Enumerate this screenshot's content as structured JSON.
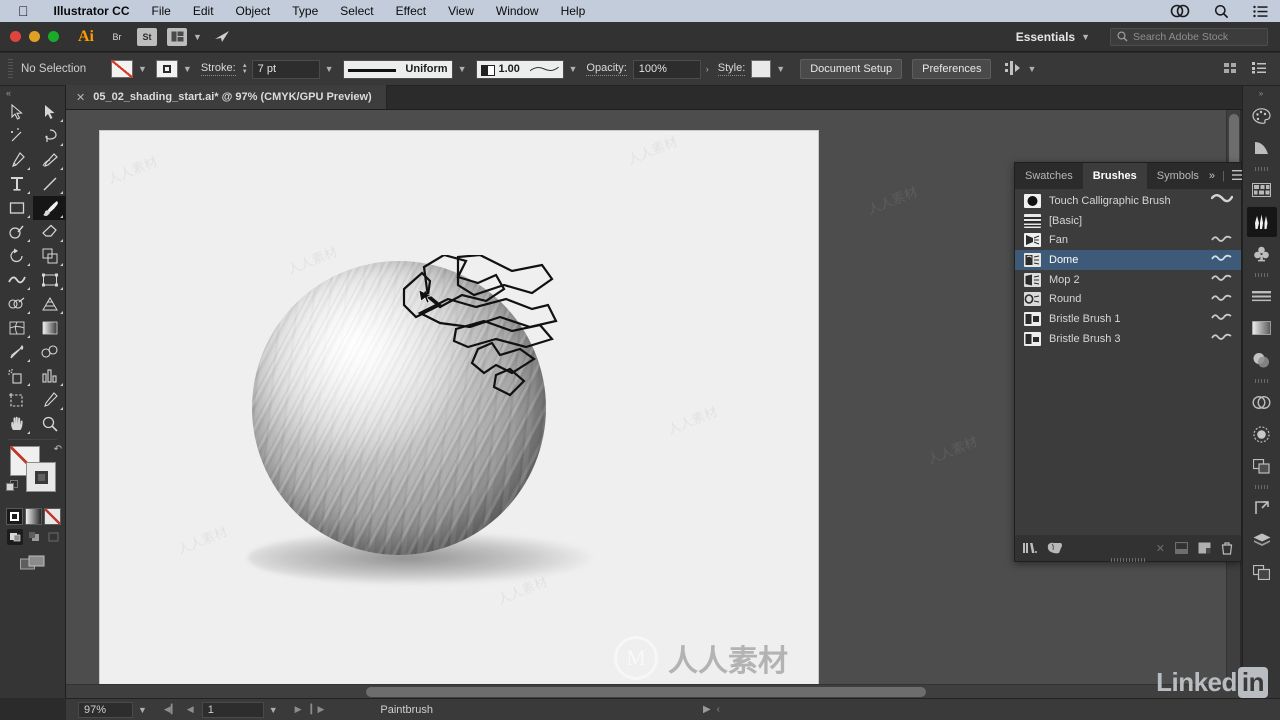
{
  "menubar": {
    "apple_icon": "apple-logo-icon",
    "app_name": "Illustrator CC",
    "items": [
      "File",
      "Edit",
      "Object",
      "Type",
      "Select",
      "Effect",
      "View",
      "Window",
      "Help"
    ],
    "right_icons": [
      "creative-cloud-icon",
      "spotlight-search-icon",
      "notification-center-icon"
    ]
  },
  "appbar": {
    "logo": "Ai",
    "buttons": [
      "bridge-icon",
      "stock-icon",
      "arrange-documents-icon"
    ],
    "mobile_icon": "share-on-behance-icon",
    "workspace": "Essentials",
    "workspace_chevron": "chevron-down-icon",
    "search": {
      "placeholder": "Search Adobe Stock",
      "icon": "search-icon"
    }
  },
  "controlbar": {
    "selection_status": "No Selection",
    "fill_swatch": "none-fill-swatch",
    "stroke_swatch": "stroke-swatch",
    "stroke_label": "Stroke:",
    "stroke_weight": "7 pt",
    "stroke_profile": "Uniform",
    "brush_definition": "1.00",
    "opacity_label": "Opacity:",
    "opacity_value": "100%",
    "style_label": "Style:",
    "document_setup": "Document Setup",
    "preferences": "Preferences",
    "right_icons": [
      "align-icon",
      "transform-icon",
      "properties-icon"
    ]
  },
  "tab": {
    "close_icon": "close-icon",
    "title": "05_02_shading_start.ai* @ 97% (CMYK/GPU Preview)"
  },
  "toolbar": {
    "tools": [
      {
        "name": "selection-tool",
        "label": "Selection"
      },
      {
        "name": "direct-selection-tool",
        "label": "Direct Selection"
      },
      {
        "name": "magic-wand-tool",
        "label": "Magic Wand"
      },
      {
        "name": "lasso-tool",
        "label": "Lasso"
      },
      {
        "name": "pen-tool",
        "label": "Pen"
      },
      {
        "name": "curvature-tool",
        "label": "Curvature"
      },
      {
        "name": "type-tool",
        "label": "Type"
      },
      {
        "name": "line-segment-tool",
        "label": "Line Segment"
      },
      {
        "name": "rectangle-tool",
        "label": "Rectangle"
      },
      {
        "name": "paintbrush-tool",
        "label": "Paintbrush"
      },
      {
        "name": "shaper-tool",
        "label": "Shaper"
      },
      {
        "name": "eraser-tool",
        "label": "Eraser"
      },
      {
        "name": "rotate-tool",
        "label": "Rotate"
      },
      {
        "name": "scale-tool",
        "label": "Scale"
      },
      {
        "name": "width-tool",
        "label": "Width"
      },
      {
        "name": "free-transform-tool",
        "label": "Free Transform"
      },
      {
        "name": "shape-builder-tool",
        "label": "Shape Builder"
      },
      {
        "name": "perspective-grid-tool",
        "label": "Perspective Grid"
      },
      {
        "name": "mesh-tool",
        "label": "Mesh"
      },
      {
        "name": "gradient-tool",
        "label": "Gradient"
      },
      {
        "name": "eyedropper-tool",
        "label": "Eyedropper"
      },
      {
        "name": "blend-tool",
        "label": "Blend"
      },
      {
        "name": "symbol-sprayer-tool",
        "label": "Symbol Sprayer"
      },
      {
        "name": "column-graph-tool",
        "label": "Column Graph"
      },
      {
        "name": "artboard-tool",
        "label": "Artboard"
      },
      {
        "name": "slice-tool",
        "label": "Slice"
      },
      {
        "name": "hand-tool",
        "label": "Hand"
      },
      {
        "name": "zoom-tool",
        "label": "Zoom"
      }
    ],
    "selected_tool": "paintbrush-tool",
    "fill_swatch": "fill-none-swatch",
    "stroke_swatch": "stroke-gray-swatch",
    "swap_icon": "swap-fill-stroke-icon",
    "default_icon": "default-fill-stroke-icon",
    "mode_buttons": [
      "color-mode-button",
      "gradient-mode-button",
      "none-mode-button"
    ],
    "draw_modes": [
      "draw-normal-button",
      "draw-behind-button",
      "draw-inside-button"
    ],
    "screen_mode": "change-screen-mode-button"
  },
  "canvas": {
    "artwork": "shaded-sphere-with-bristle-brush-strokes",
    "selected_path": "bristle-brush-path-outline",
    "cursor": "paintbrush-cursor"
  },
  "panel": {
    "tabs": [
      {
        "label": "Swatches",
        "active": false
      },
      {
        "label": "Brushes",
        "active": true
      },
      {
        "label": "Symbols",
        "active": false
      }
    ],
    "expand_icon": "double-chevron-right-icon",
    "menu_icon": "panel-menu-icon",
    "brushes": [
      {
        "name": "Touch Calligraphic Brush",
        "type": "calligraphic",
        "selected": false,
        "has_preview": true
      },
      {
        "name": "[Basic]",
        "type": "basic",
        "selected": false,
        "has_preview": false
      },
      {
        "name": "Fan",
        "type": "bristle",
        "selected": false,
        "has_preview": true
      },
      {
        "name": "Dome",
        "type": "bristle",
        "selected": true,
        "has_preview": true
      },
      {
        "name": "Mop 2",
        "type": "bristle",
        "selected": false,
        "has_preview": true
      },
      {
        "name": "Round",
        "type": "bristle",
        "selected": false,
        "has_preview": true
      },
      {
        "name": "Bristle Brush 1",
        "type": "bristle",
        "selected": false,
        "has_preview": true
      },
      {
        "name": "Bristle Brush 3",
        "type": "bristle",
        "selected": false,
        "has_preview": true
      }
    ],
    "footer_icons": [
      {
        "name": "brush-libraries-menu-icon",
        "dimmed": false
      },
      {
        "name": "libraries-icon",
        "dimmed": false
      },
      {
        "name": "remove-brush-stroke-icon",
        "dimmed": true
      },
      {
        "name": "options-of-selected-object-icon",
        "dimmed": true
      },
      {
        "name": "new-brush-icon",
        "dimmed": false
      },
      {
        "name": "delete-brush-icon",
        "dimmed": false
      }
    ],
    "selection_color": "#3d5a78"
  },
  "dock": {
    "items": [
      {
        "name": "color-panel-icon",
        "selected": false
      },
      {
        "name": "color-guide-panel-icon",
        "selected": false
      },
      {
        "name": "swatches-panel-icon",
        "selected": false
      },
      {
        "name": "brushes-panel-icon",
        "selected": true
      },
      {
        "name": "symbols-panel-icon",
        "selected": false
      },
      {
        "name": "stroke-panel-icon",
        "selected": false
      },
      {
        "name": "gradient-panel-icon",
        "selected": false
      },
      {
        "name": "transparency-panel-icon",
        "selected": false
      },
      {
        "name": "appearance-panel-icon",
        "selected": false
      },
      {
        "name": "graphic-styles-panel-icon",
        "selected": false
      },
      {
        "name": "pathfinder-panel-icon",
        "selected": false
      },
      {
        "name": "align-panel-icon",
        "selected": false
      },
      {
        "name": "layers-panel-icon",
        "selected": false
      },
      {
        "name": "artboards-panel-icon",
        "selected": false
      }
    ]
  },
  "statusbar": {
    "zoom": "97%",
    "zoom_chevron": "chevron-down-icon",
    "first_page_icon": "first-artboard-icon",
    "prev_page_icon": "previous-artboard-icon",
    "artboard_number": "1",
    "artboard_chevron": "chevron-down-icon",
    "next_page_icon": "next-artboard-icon",
    "last_page_icon": "last-artboard-icon",
    "status_text": "Paintbrush",
    "status_arrow": "play-arrow-icon",
    "resize_grip": "resize-grip-icon"
  },
  "watermarks": {
    "text": "人人素材",
    "brand": "Linked",
    "brand_suffix": "in"
  },
  "colors": {
    "accent_blue": "#3d5a78",
    "panel_bg": "#3c3c3c",
    "chrome_bg": "#353535",
    "canvas_bg": "#4d4d4d",
    "artboard_bg": "#efefef",
    "menubar_bg": "#c3ccdb",
    "ai_orange": "#ff9a00"
  }
}
